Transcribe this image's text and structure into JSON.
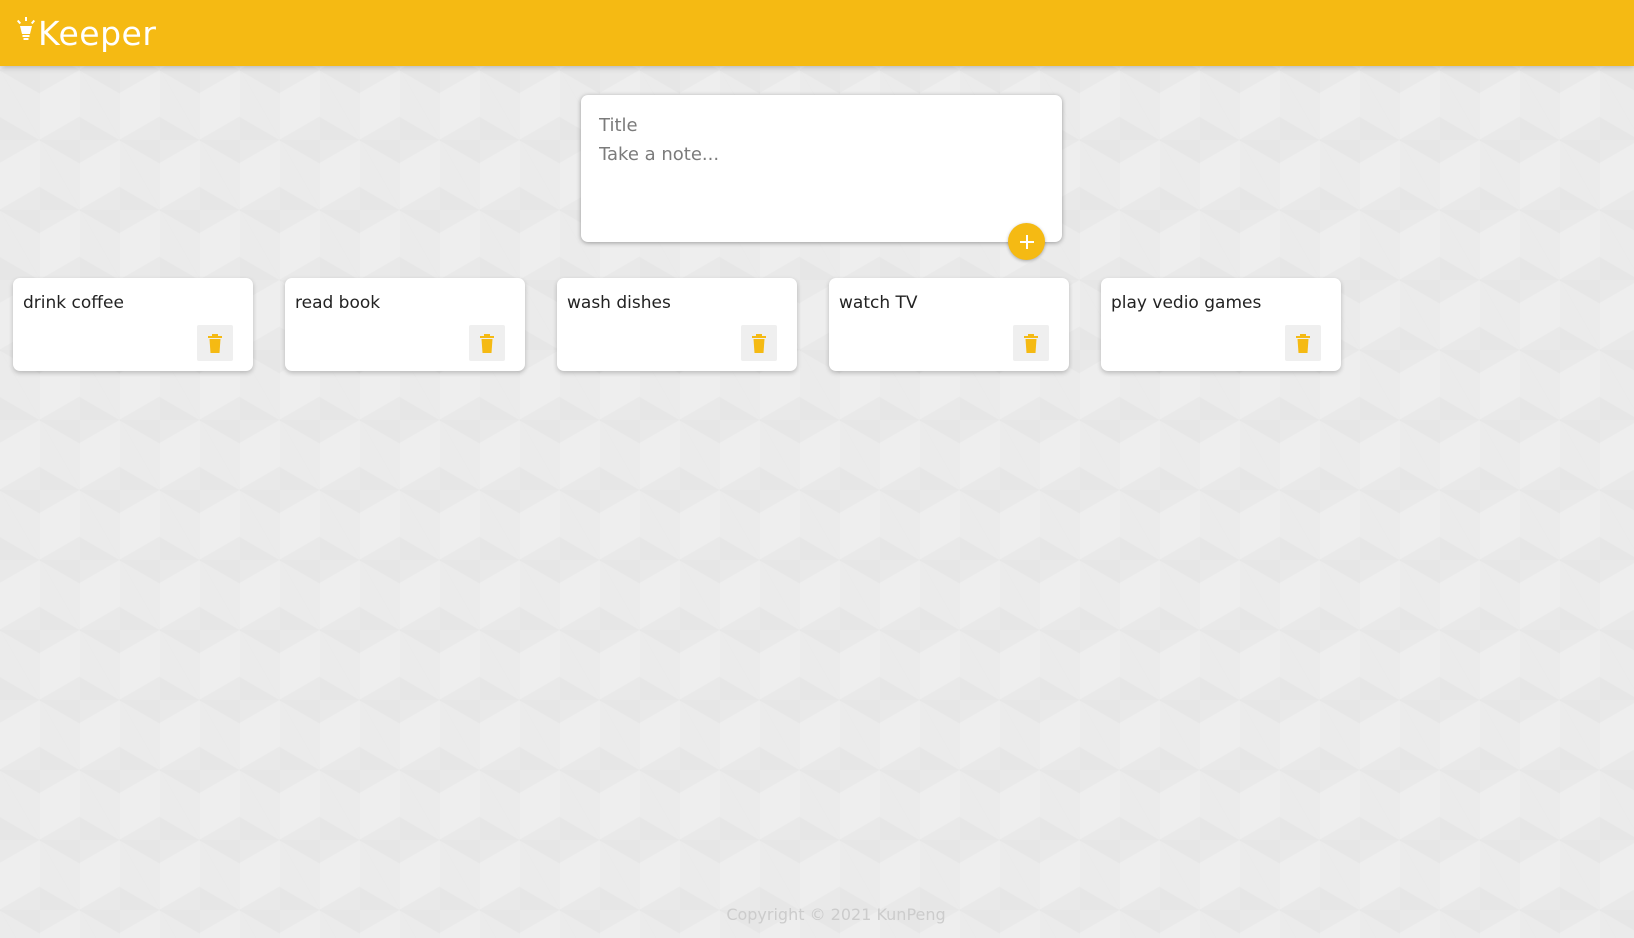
{
  "header": {
    "brand_name": "Keeper",
    "brand_icon": "lightbulb-icon",
    "color": "#f5ba13"
  },
  "create_area": {
    "title_placeholder": "Title",
    "content_placeholder": "Take a note...",
    "add_button_icon": "plus-icon"
  },
  "notes": [
    {
      "title": "drink coffee",
      "delete_icon": "trash-icon"
    },
    {
      "title": "read book",
      "delete_icon": "trash-icon"
    },
    {
      "title": "wash dishes",
      "delete_icon": "trash-icon"
    },
    {
      "title": "watch TV",
      "delete_icon": "trash-icon"
    },
    {
      "title": "play vedio games",
      "delete_icon": "trash-icon"
    }
  ],
  "footer": {
    "copyright": "Copyright © 2021 KunPeng"
  },
  "colors": {
    "accent": "#f5ba13",
    "background": "#eeeeee",
    "card": "#ffffff"
  }
}
